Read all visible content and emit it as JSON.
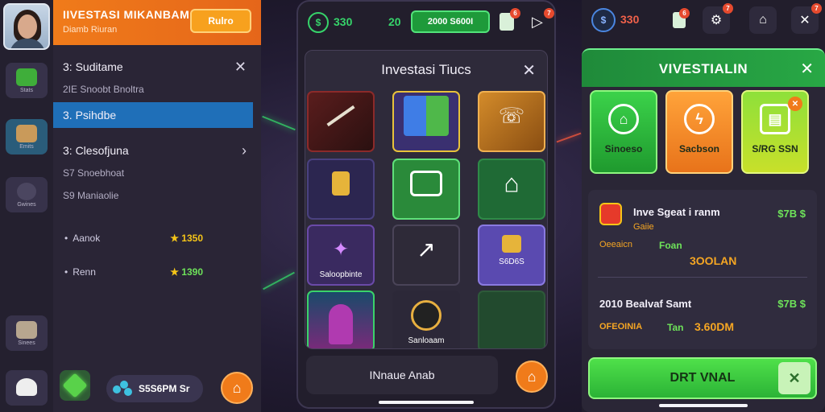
{
  "left_sidebar": {
    "buttons": [
      {
        "label": "Stats",
        "icon": "money-stack-icon"
      },
      {
        "label": "Emits",
        "icon": "crate-icon"
      },
      {
        "label": "Gwines",
        "icon": "skull-icon"
      },
      {
        "label": "Sinees",
        "icon": "box-icon"
      },
      {
        "label": "",
        "icon": "cat-icon"
      }
    ]
  },
  "menu_panel": {
    "title": "IIVESTASI MIKANBAM",
    "subtitle": "Diamb Riuran",
    "header_button": "Rulro",
    "rows": [
      {
        "text": "3:  Suditame"
      },
      {
        "text": "2IE  Snoobt Bnoltra"
      },
      {
        "text": "3.   Psihdbe"
      },
      {
        "text": "3:  Clesofjuna"
      },
      {
        "text": "S7  Snoebhoat"
      },
      {
        "text": "S9  Maniaolie"
      }
    ],
    "rewards": [
      {
        "label": "Aanok",
        "value": "1350"
      },
      {
        "label": "Renn",
        "value": "1390"
      }
    ],
    "footer_pill": "S5S6PM Sr"
  },
  "middle_phone": {
    "topbar": {
      "coin_symbol": "$",
      "coin_value": "330",
      "value2": "20",
      "pill_label": "2000 S600I",
      "badge1": "6",
      "badge2": "7"
    },
    "modal_title": "Investasi Tiucs",
    "tiles": [
      {
        "label": ""
      },
      {
        "label": ""
      },
      {
        "label": ""
      },
      {
        "label": ""
      },
      {
        "label": ""
      },
      {
        "label": ""
      },
      {
        "label": "Saloopbinte"
      },
      {
        "label": ""
      },
      {
        "label": "S6D6S"
      },
      {
        "label": ""
      },
      {
        "label": "Sanloaam"
      },
      {
        "label": ""
      }
    ],
    "footer_label": "INnaue Anab"
  },
  "right_phone": {
    "topbar": {
      "coin_symbol": "$",
      "coin_value": "330",
      "badge1": "6",
      "badge2": "7",
      "badge3": "7"
    },
    "modal_title": "VIVESTIALIN",
    "cards": [
      {
        "label": "Sinoeso",
        "icon": "home-badge-icon"
      },
      {
        "label": "Sacbson",
        "icon": "lightning-icon"
      },
      {
        "label": "S/RG SSN",
        "icon": "register-icon"
      }
    ],
    "entries": [
      {
        "title": "Inve Sgeat i ranm",
        "value": "$7B $",
        "sub_left": "Gaiie",
        "sub_left2": "Oeeaicn",
        "sub_mid": "Foan",
        "amount": "3OOLAN"
      },
      {
        "title": "2010   Bealvaf Samt",
        "value": "$7B $",
        "sub_left2": "OFEOINIA",
        "sub_mid": "Tan",
        "amount": "3.60DM"
      }
    ],
    "cta_label": "DRT VNAL"
  },
  "colors": {
    "accent_orange": "#f07b1a",
    "accent_green": "#2bb336",
    "selected_blue": "#1f6fb8",
    "gold": "#f5c518"
  }
}
